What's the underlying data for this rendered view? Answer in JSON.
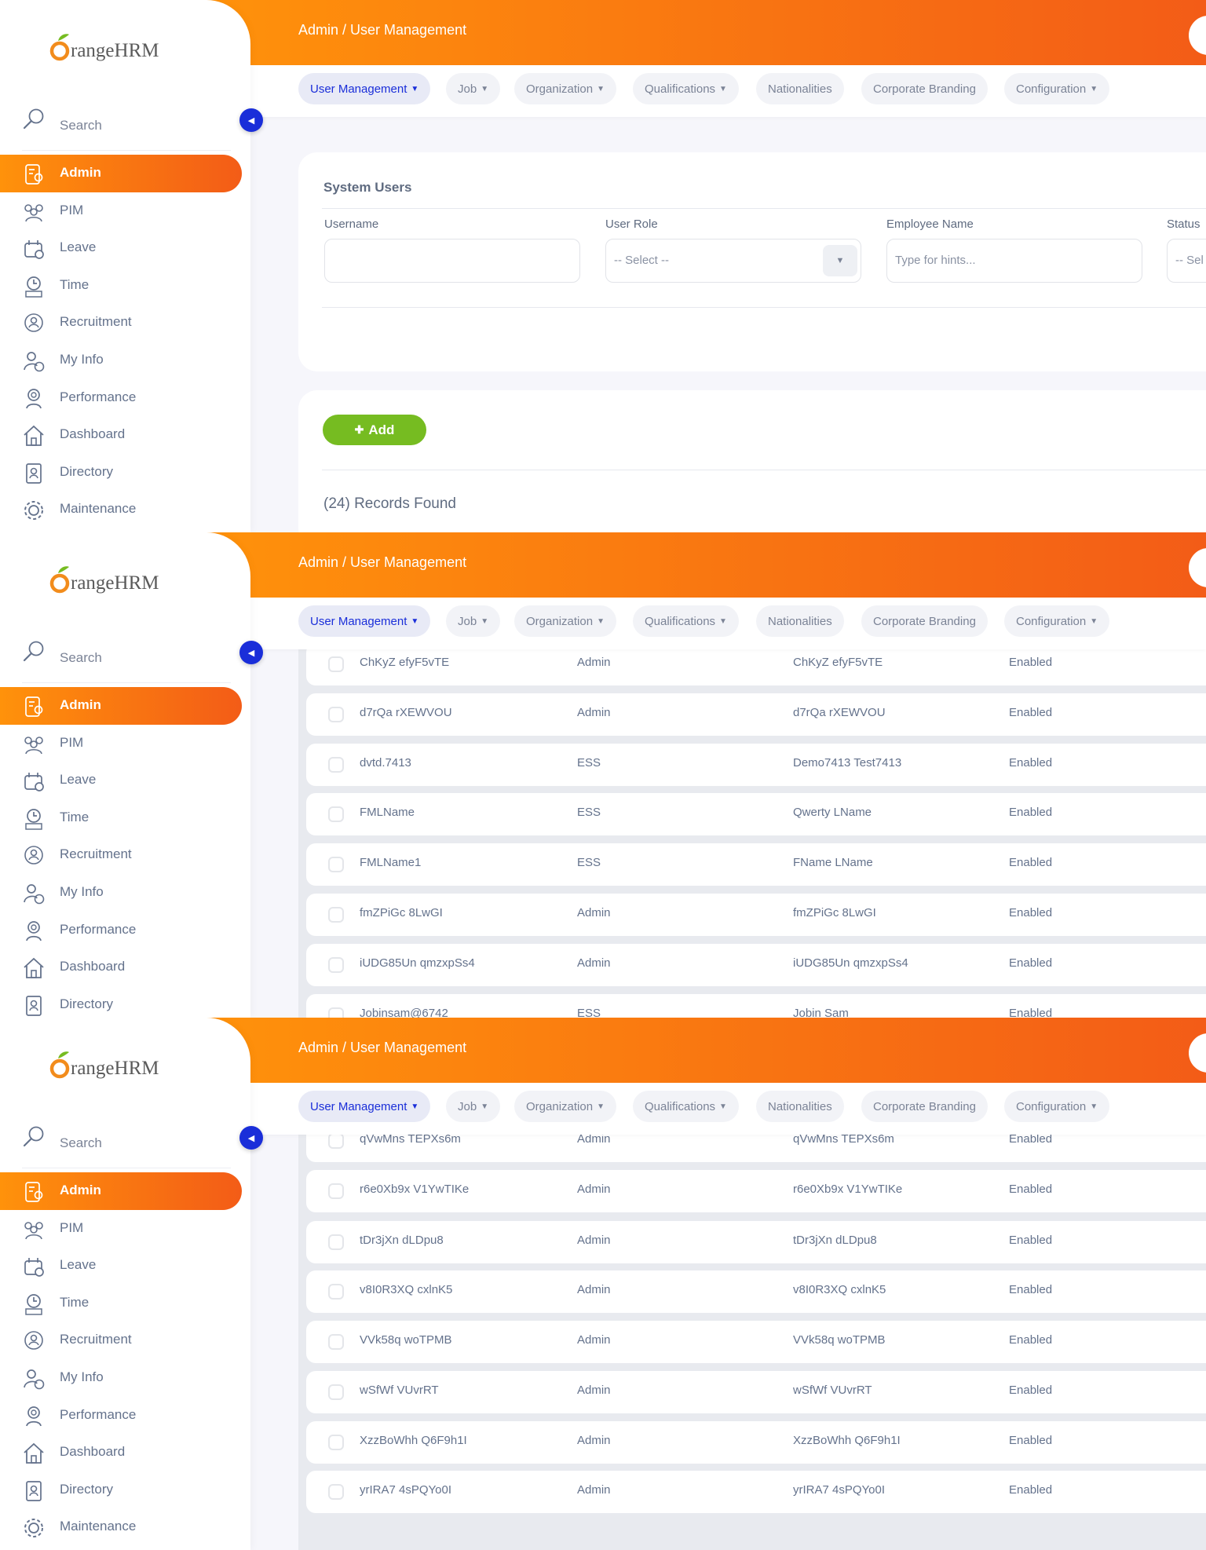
{
  "brand": {
    "logo_text": "OrangeHRM"
  },
  "sidebar": {
    "search_label": "Search",
    "toggle_icon": "chevron-left-icon",
    "items": [
      {
        "label": "Admin",
        "icon": "admin-icon",
        "active": true
      },
      {
        "label": "PIM",
        "icon": "pim-icon"
      },
      {
        "label": "Leave",
        "icon": "leave-icon"
      },
      {
        "label": "Time",
        "icon": "time-icon"
      },
      {
        "label": "Recruitment",
        "icon": "recruitment-icon"
      },
      {
        "label": "My Info",
        "icon": "my-info-icon"
      },
      {
        "label": "Performance",
        "icon": "performance-icon"
      },
      {
        "label": "Dashboard",
        "icon": "dashboard-icon"
      },
      {
        "label": "Directory",
        "icon": "directory-icon"
      },
      {
        "label": "Maintenance",
        "icon": "maintenance-icon"
      }
    ]
  },
  "header": {
    "breadcrumb": "Admin / User Management"
  },
  "tabs": [
    {
      "label": "User Management",
      "chevron": true,
      "active": true
    },
    {
      "label": "Job",
      "chevron": true
    },
    {
      "label": "Organization",
      "chevron": true
    },
    {
      "label": "Qualifications",
      "chevron": true
    },
    {
      "label": "Nationalities",
      "chevron": false
    },
    {
      "label": "Corporate Branding",
      "chevron": false
    },
    {
      "label": "Configuration",
      "chevron": true
    }
  ],
  "filter": {
    "title": "System Users",
    "username_label": "Username",
    "username_value": "",
    "role_label": "User Role",
    "role_value": "-- Select --",
    "employee_label": "Employee Name",
    "employee_placeholder": "Type for hints...",
    "status_label": "Status",
    "status_value": "-- Sel"
  },
  "actions": {
    "add_label": "Add",
    "add_icon": "plus-icon"
  },
  "records_found": "(24) Records Found",
  "rows_segment2": [
    {
      "username": "ChKyZ efyF5vTE",
      "role": "Admin",
      "employee": "ChKyZ efyF5vTE",
      "status": "Enabled"
    },
    {
      "username": "d7rQa rXEWVOU",
      "role": "Admin",
      "employee": "d7rQa rXEWVOU",
      "status": "Enabled"
    },
    {
      "username": "dvtd.7413",
      "role": "ESS",
      "employee": "Demo7413 Test7413",
      "status": "Enabled"
    },
    {
      "username": "FMLName",
      "role": "ESS",
      "employee": "Qwerty LName",
      "status": "Enabled"
    },
    {
      "username": "FMLName1",
      "role": "ESS",
      "employee": "FName LName",
      "status": "Enabled"
    },
    {
      "username": "fmZPiGc 8LwGI",
      "role": "Admin",
      "employee": "fmZPiGc 8LwGI",
      "status": "Enabled"
    },
    {
      "username": "iUDG85Un qmzxpSs4",
      "role": "Admin",
      "employee": "iUDG85Un qmzxpSs4",
      "status": "Enabled"
    },
    {
      "username": "Jobinsam@6742",
      "role": "ESS",
      "employee": "Jobin Sam",
      "status": "Enabled"
    }
  ],
  "rows_segment3": [
    {
      "username": "qVwMns TEPXs6m",
      "role": "Admin",
      "employee": "qVwMns TEPXs6m",
      "status": "Enabled"
    },
    {
      "username": "r6e0Xb9x V1YwTIKe",
      "role": "Admin",
      "employee": "r6e0Xb9x V1YwTIKe",
      "status": "Enabled"
    },
    {
      "username": "tDr3jXn dLDpu8",
      "role": "Admin",
      "employee": "tDr3jXn dLDpu8",
      "status": "Enabled"
    },
    {
      "username": "v8I0R3XQ cxlnK5",
      "role": "Admin",
      "employee": "v8I0R3XQ cxlnK5",
      "status": "Enabled"
    },
    {
      "username": "VVk58q woTPMB",
      "role": "Admin",
      "employee": "VVk58q woTPMB",
      "status": "Enabled"
    },
    {
      "username": "wSfWf VUvrRT",
      "role": "Admin",
      "employee": "wSfWf VUvrRT",
      "status": "Enabled"
    },
    {
      "username": "XzzBoWhh Q6F9h1I",
      "role": "Admin",
      "employee": "XzzBoWhh Q6F9h1I",
      "status": "Enabled"
    },
    {
      "username": "yrIRA7 4sPQYo0I",
      "role": "Admin",
      "employee": "yrIRA7 4sPQYo0I",
      "status": "Enabled"
    }
  ],
  "colors": {
    "accent_start": "#ff920b",
    "accent_end": "#f35c17",
    "active_tab": "#1a2ed9",
    "add_button": "#76bc21"
  }
}
